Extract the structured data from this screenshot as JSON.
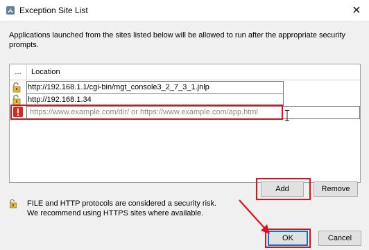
{
  "window": {
    "title": "Exception Site List",
    "close_label": "✕"
  },
  "description": "Applications launched from the sites listed below will be allowed to run after the appropriate security prompts.",
  "table": {
    "columns": [
      "...",
      "Location"
    ],
    "rows": [
      {
        "icon": "lock-open-icon",
        "location": "http://192.168.1.1/cgi-bin/mgt_console3_2_7_3_1.jnlp"
      },
      {
        "icon": "lock-open-icon",
        "location": "http://192.168.1.34"
      }
    ],
    "new_row": {
      "icon": "error-icon",
      "placeholder": "https://www.example.com/dir/ or https://www.example.com/app.html"
    }
  },
  "buttons": {
    "add": "Add",
    "remove": "Remove",
    "ok": "OK",
    "cancel": "Cancel"
  },
  "risk_note": {
    "line1": "FILE and HTTP protocols are considered a security risk.",
    "line2": "We recommend using HTTPS sites where available."
  },
  "colors": {
    "highlight": "#e0101a",
    "ok_border": "#0078d7"
  }
}
